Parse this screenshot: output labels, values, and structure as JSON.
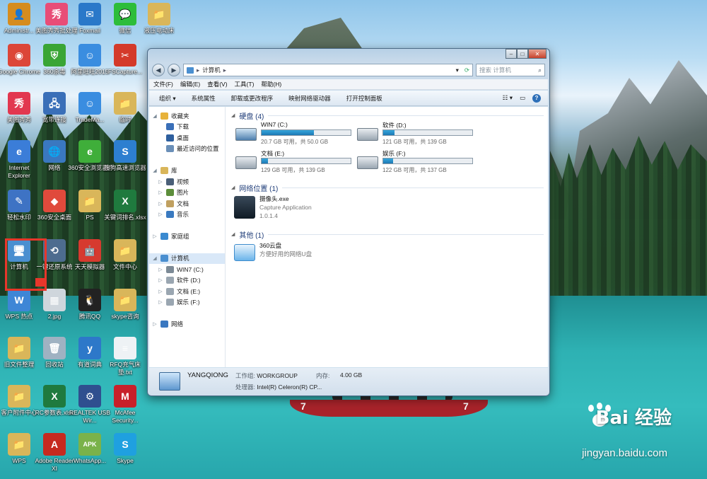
{
  "desktop_icons": [
    {
      "label": "Administr...",
      "color": "#d58c1f",
      "glyph": "👤",
      "icon": "user-folder-icon"
    },
    {
      "label": "美图秀秀批处理",
      "color": "#e84d77",
      "glyph": "秀",
      "icon": "meitu-batch-icon"
    },
    {
      "label": "Foxmail",
      "color": "#2a78c9",
      "glyph": "✉",
      "icon": "foxmail-icon"
    },
    {
      "label": "微信",
      "color": "#2dbd3a",
      "glyph": "💬",
      "icon": "wechat-icon"
    },
    {
      "label": "液压电动床",
      "color": "#d9b65a",
      "glyph": "📁",
      "icon": "folder-icon"
    },
    {
      "label": "Google Chrome",
      "color": "#dc4638",
      "glyph": "◉",
      "icon": "chrome-icon"
    },
    {
      "label": "360杀毒",
      "color": "#3aa535",
      "glyph": "⛨",
      "icon": "360-antivirus-icon"
    },
    {
      "label": "阿里旺旺2015",
      "color": "#3a8de0",
      "glyph": "☺",
      "icon": "aliwangwang-icon"
    },
    {
      "label": "FSCapture...",
      "color": "#d43a2a",
      "glyph": "✂",
      "icon": "fscapture-icon"
    },
    {
      "label": "美图秀秀",
      "color": "#e2374f",
      "glyph": "秀",
      "icon": "meitu-icon"
    },
    {
      "label": "宽带连接",
      "color": "#3a6fb8",
      "glyph": "🖧",
      "icon": "broadband-icon"
    },
    {
      "label": "TradeMa...",
      "color": "#3a8de0",
      "glyph": "☺",
      "icon": "trademanager-icon"
    },
    {
      "label": "临时",
      "color": "#d9b65a",
      "glyph": "📁",
      "icon": "folder-icon"
    },
    {
      "label": "Internet Explorer",
      "color": "#3b7dd8",
      "glyph": "e",
      "icon": "ie-icon"
    },
    {
      "label": "网络",
      "color": "#3a78c0",
      "glyph": "🌐",
      "icon": "network-icon"
    },
    {
      "label": "360安全浏览器7",
      "color": "#3fae3a",
      "glyph": "e",
      "icon": "360-browser-icon"
    },
    {
      "label": "搜狗高速浏览器",
      "color": "#2d7fd0",
      "glyph": "S",
      "icon": "sogou-browser-icon"
    },
    {
      "label": "轻松水印",
      "color": "#3e73c4",
      "glyph": "✎",
      "icon": "watermark-icon"
    },
    {
      "label": "360安全桌面",
      "color": "#e04a3c",
      "glyph": "◆",
      "icon": "360-desktop-icon"
    },
    {
      "label": "PS",
      "color": "#d9b65a",
      "glyph": "📁",
      "icon": "folder-icon"
    },
    {
      "label": "关键词排名.xlsx",
      "color": "#1f7a3e",
      "glyph": "X",
      "icon": "excel-file-icon"
    },
    {
      "label": "计算机",
      "color": "#4a8fd0",
      "glyph": "🖥",
      "icon": "computer-icon"
    },
    {
      "label": "一键还原系统",
      "color": "#4d6c8f",
      "glyph": "⟲",
      "icon": "restore-icon"
    },
    {
      "label": "天天模拟器",
      "color": "#d63a2f",
      "glyph": "🤖",
      "icon": "emulator-icon"
    },
    {
      "label": "文件中心",
      "color": "#d9b65a",
      "glyph": "📁",
      "icon": "folder-icon"
    },
    {
      "label": "WPS 热点",
      "color": "#3e86d6",
      "glyph": "W",
      "icon": "wps-hot-icon"
    },
    {
      "label": "2.jpg",
      "color": "#cfd6dc",
      "glyph": "▦",
      "icon": "image-file-icon"
    },
    {
      "label": "腾讯QQ",
      "color": "#222222",
      "glyph": "🐧",
      "icon": "qq-icon"
    },
    {
      "label": "skype咨询",
      "color": "#d9b65a",
      "glyph": "📁",
      "icon": "folder-icon"
    },
    {
      "label": "旧文件整理",
      "color": "#d9b65a",
      "glyph": "📁",
      "icon": "folder-icon"
    },
    {
      "label": "回收站",
      "color": "#9fb2c2",
      "glyph": "🗑",
      "icon": "recycle-bin-icon"
    },
    {
      "label": "有道词典",
      "color": "#2d78c9",
      "glyph": "y",
      "icon": "youdao-icon"
    },
    {
      "label": "RFQ充气床垫.txt",
      "color": "#eef2f5",
      "glyph": "≡",
      "icon": "text-file-icon"
    },
    {
      "label": "客户附件中心",
      "color": "#d9b65a",
      "glyph": "📁",
      "icon": "folder-icon"
    },
    {
      "label": "RC参数表.xlsx",
      "color": "#1f7a3e",
      "glyph": "X",
      "icon": "excel-file-icon"
    },
    {
      "label": "REALTEK USB Wir...",
      "color": "#2f4f8f",
      "glyph": "⚙",
      "icon": "realtek-icon"
    },
    {
      "label": "McAfee Security...",
      "color": "#c8202a",
      "glyph": "M",
      "icon": "mcafee-icon"
    },
    {
      "label": "WPS",
      "color": "#d9b65a",
      "glyph": "📁",
      "icon": "folder-icon"
    },
    {
      "label": "Adobe Reader XI",
      "color": "#c62a1f",
      "glyph": "A",
      "icon": "adobe-reader-icon"
    },
    {
      "label": "WhatsApp...",
      "color": "#7ab24a",
      "glyph": "APK",
      "icon": "apk-icon"
    },
    {
      "label": "Skype",
      "color": "#1fa0e0",
      "glyph": "S",
      "icon": "skype-icon"
    }
  ],
  "window": {
    "address_root": "计算机",
    "search_placeholder": "搜索 计算机",
    "menu": [
      "文件(F)",
      "编辑(E)",
      "查看(V)",
      "工具(T)",
      "帮助(H)"
    ],
    "toolbar": [
      "组织 ▾",
      "系统属性",
      "卸载或更改程序",
      "映射网络驱动器",
      "打开控制面板"
    ],
    "nav": [
      {
        "label": "收藏夹",
        "indent": 0,
        "color": "#e7b23a",
        "arrow": "◢",
        "icon": "favorites-icon"
      },
      {
        "label": "下载",
        "indent": 1,
        "color": "#3a6fb8",
        "arrow": "",
        "icon": "downloads-icon"
      },
      {
        "label": "桌面",
        "indent": 1,
        "color": "#2e5f9e",
        "arrow": "",
        "icon": "desktop-icon"
      },
      {
        "label": "最近访问的位置",
        "indent": 1,
        "color": "#6a8fb8",
        "arrow": "",
        "icon": "recent-places-icon"
      },
      {
        "label": "",
        "indent": 0,
        "color": "",
        "arrow": "",
        "icon": "spacer-icon"
      },
      {
        "label": "库",
        "indent": 0,
        "color": "#d9b65a",
        "arrow": "◢",
        "icon": "libraries-icon"
      },
      {
        "label": "视频",
        "indent": 1,
        "color": "#4a5f78",
        "arrow": "▷",
        "icon": "videos-icon"
      },
      {
        "label": "图片",
        "indent": 1,
        "color": "#5c8d3a",
        "arrow": "▷",
        "icon": "pictures-icon"
      },
      {
        "label": "文档",
        "indent": 1,
        "color": "#c0a060",
        "arrow": "▷",
        "icon": "documents-icon"
      },
      {
        "label": "音乐",
        "indent": 1,
        "color": "#3a7ac0",
        "arrow": "▷",
        "icon": "music-icon"
      },
      {
        "label": "",
        "indent": 0,
        "color": "",
        "arrow": "",
        "icon": "spacer-icon"
      },
      {
        "label": "家庭组",
        "indent": 0,
        "color": "#3a8ad0",
        "arrow": "▷",
        "icon": "homegroup-icon"
      },
      {
        "label": "",
        "indent": 0,
        "color": "",
        "arrow": "",
        "icon": "spacer-icon"
      },
      {
        "label": "计算机",
        "indent": 0,
        "color": "#4a8fd0",
        "arrow": "◢",
        "icon": "computer-icon",
        "selected": true
      },
      {
        "label": "WIN7 (C:)",
        "indent": 1,
        "color": "#7c8a96",
        "arrow": "▷",
        "icon": "drive-c-icon"
      },
      {
        "label": "软件 (D:)",
        "indent": 1,
        "color": "#9aa6b1",
        "arrow": "▷",
        "icon": "drive-d-icon"
      },
      {
        "label": "文档 (E:)",
        "indent": 1,
        "color": "#9aa6b1",
        "arrow": "▷",
        "icon": "drive-e-icon"
      },
      {
        "label": "娱乐 (F:)",
        "indent": 1,
        "color": "#9aa6b1",
        "arrow": "▷",
        "icon": "drive-f-icon"
      },
      {
        "label": "",
        "indent": 0,
        "color": "",
        "arrow": "",
        "icon": "spacer-icon"
      },
      {
        "label": "网络",
        "indent": 0,
        "color": "#3a78c0",
        "arrow": "▷",
        "icon": "network-icon"
      }
    ],
    "groups": {
      "drives_title": "硬盘 (4)",
      "netloc_title": "网络位置 (1)",
      "other_title": "其他 (1)"
    },
    "drives": [
      {
        "name": "WIN7 (C:)",
        "free": "20.7 GB 可用，共 50.0 GB",
        "used_fraction": 0.586
      },
      {
        "name": "软件 (D:)",
        "free": "121 GB 可用，共 139 GB",
        "used_fraction": 0.13
      },
      {
        "name": "文档 (E:)",
        "free": "129 GB 可用，共 139 GB",
        "used_fraction": 0.07
      },
      {
        "name": "娱乐 (F:)",
        "free": "122 GB 可用，共 137 GB",
        "used_fraction": 0.11
      }
    ],
    "netloc": {
      "name": "摄像头.exe",
      "line2": "Capture Application",
      "line3": "1.0.1.4"
    },
    "other": {
      "name": "360云盘",
      "line2": "方便好用的网络U盘"
    },
    "status": {
      "pc_name": "YANGQIONG",
      "workgroup_label": "工作组:",
      "workgroup": "WORKGROUP",
      "memory_label": "内存:",
      "memory": "4.00 GB",
      "cpu_label": "处理器:",
      "cpu": "Intel(R) Celeron(R) CP..."
    }
  },
  "watermark": {
    "brand": "Bai  经验",
    "url": "jingyan.baidu.com"
  }
}
